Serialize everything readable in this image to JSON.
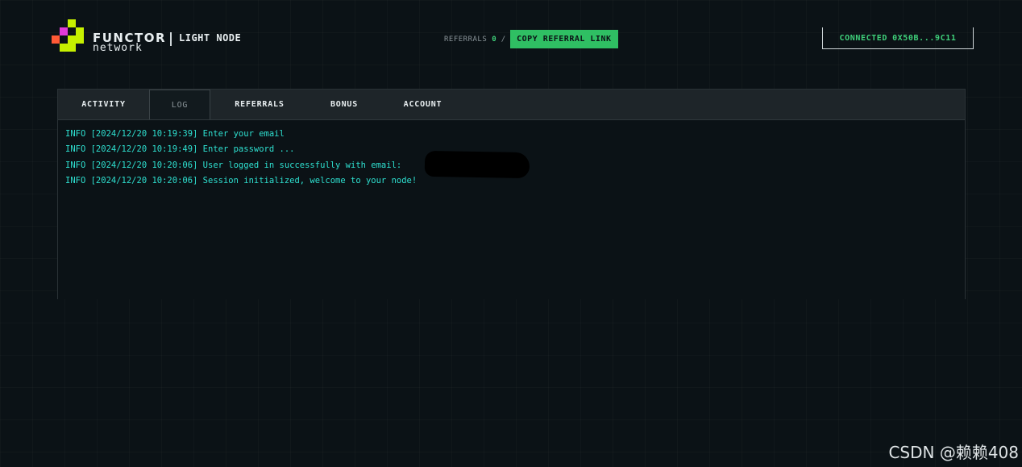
{
  "header": {
    "brand_name": "FUNCTOR",
    "brand_sub": "network",
    "product": "LIGHT NODE",
    "referrals_label": "REFERRALS",
    "referrals_count": "0",
    "referrals_sep": "/",
    "copy_label": "COPY REFERRAL LINK",
    "connected_label": "CONNECTED",
    "connected_address": "0X50B...9C11"
  },
  "logo_colors": {
    "lime": "#c6f000",
    "magenta": "#e23bd8",
    "orange": "#ff5a36"
  },
  "tabs": [
    {
      "label": "ACTIVITY",
      "active": false
    },
    {
      "label": "LOG",
      "active": true
    },
    {
      "label": "REFERRALS",
      "active": false
    },
    {
      "label": "BONUS",
      "active": false
    },
    {
      "label": "ACCOUNT",
      "active": false
    }
  ],
  "log": [
    "INFO [2024/12/20 10:19:39] Enter your email",
    "INFO [2024/12/20 10:19:49] Enter password ...",
    "INFO [2024/12/20 10:20:06] User logged in successfully with email:",
    "INFO [2024/12/20 10:20:06] Session initialized, welcome to your node!"
  ],
  "watermark": "CSDN @赖赖408"
}
